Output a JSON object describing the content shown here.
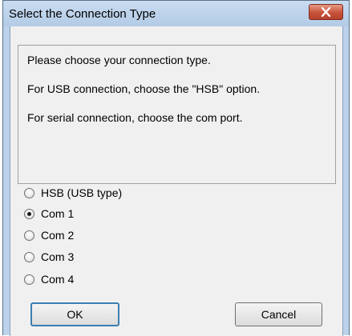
{
  "dialog": {
    "title": "Select the Connection Type",
    "close_glyph": "✕"
  },
  "info": {
    "lines": [
      "Please choose your connection type.",
      "For USB connection, choose the \"HSB\" option.",
      "For serial connection, choose the com port."
    ]
  },
  "options": [
    {
      "label": "HSB (USB type)",
      "checked": false
    },
    {
      "label": "Com 1",
      "checked": true
    },
    {
      "label": "Com 2",
      "checked": false
    },
    {
      "label": "Com 3",
      "checked": false
    },
    {
      "label": "Com 4",
      "checked": false
    }
  ],
  "buttons": {
    "ok_label": "OK",
    "cancel_label": "Cancel"
  },
  "colors": {
    "title_bar": "#bcd2eb",
    "close_button": "#c7523a",
    "client_background": "#f0f0f0"
  }
}
